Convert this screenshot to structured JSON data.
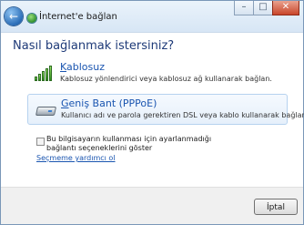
{
  "window": {
    "title": "İnternet'e bağlan",
    "caption_buttons": {
      "minimize": "–",
      "maximize": "□",
      "close": "✕"
    }
  },
  "main": {
    "heading": "Nasıl bağlanmak istersiniz?",
    "options": [
      {
        "title_first": "K",
        "title_rest": "ablosuz",
        "description": "Kablosuz yönlendirici veya kablosuz ağ kullanarak bağlan.",
        "icon": "signal-bars-icon"
      },
      {
        "title_first": "G",
        "title_rest": "eniş Bant (PPPoE)",
        "description": "Kullanıcı adı ve parola gerektiren DSL veya kablo kullanarak bağlan.",
        "icon": "broadband-modem-icon"
      }
    ],
    "checkbox_label": "Bu bilgisayarın kullanması için ayarlanmadığı bağlantı seçeneklerini göster",
    "help_link": "Seçmeme yardımcı ol"
  },
  "footer": {
    "cancel_label": "İptal"
  },
  "colors": {
    "heading": "#1e3a78",
    "link": "#1a55b0",
    "selected_option_bg": "#e6f0fb"
  }
}
